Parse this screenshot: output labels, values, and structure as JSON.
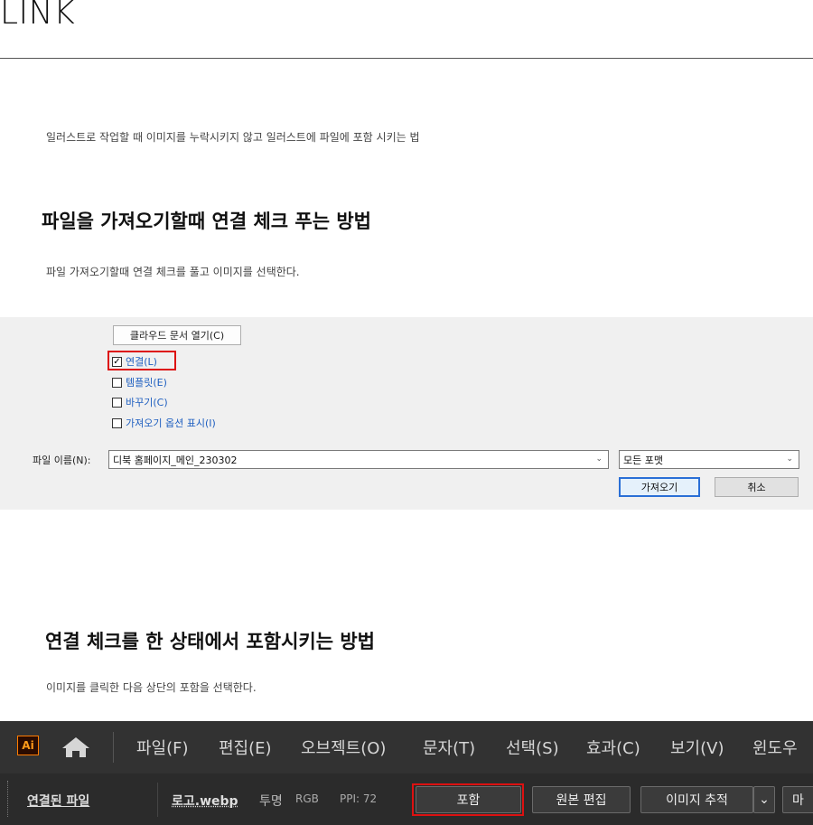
{
  "page": {
    "title": "LINK",
    "intro": "일러스트로 작업할 때 이미지를 누락시키지 않고 일러스트에 파일에 포함 시키는 법",
    "section1": {
      "heading": "파일을 가져오기할때 연결 체크 푸는 방법",
      "desc": "파일 가져오기할때 연결 체크를 풀고 이미지를 선택한다."
    },
    "section2": {
      "heading": "연결 체크를 한 상태에서 포함시키는 방법",
      "desc": "이미지를 클릭한 다음 상단의 포함을 선택한다."
    }
  },
  "dialog": {
    "cloud_button": "클라우드 문서 열기(C)",
    "options": [
      {
        "label": "연결(L)",
        "checked": true
      },
      {
        "label": "템플릿(E)",
        "checked": false
      },
      {
        "label": "바꾸기(C)",
        "checked": false
      },
      {
        "label": "가져오기 옵션 표시(I)",
        "checked": false
      }
    ],
    "filename_label": "파일 이름(N):",
    "filename_value": "디북 홈페이지_메인_230302",
    "format_value": "모든 포맷",
    "import_button": "가져오기",
    "cancel_button": "취소"
  },
  "illustrator": {
    "logo": "Ai",
    "menu": [
      "파일(F)",
      "편집(E)",
      "오브젝트(O)",
      "문자(T)",
      "선택(S)",
      "효과(C)",
      "보기(V)",
      "윈도우"
    ],
    "control": {
      "linked_file": "연결된 파일",
      "filename": "로고.webp",
      "transparency": "투명",
      "color_mode": "RGB",
      "ppi": "PPI: 72",
      "embed_button": "포함",
      "edit_original_button": "원본 편집",
      "image_trace_button": "이미지 추적",
      "trailing_button": "마"
    }
  },
  "colors": {
    "highlight": "#d11111",
    "link_blue": "#1e5fc0",
    "ai_orange": "#ff9a1a"
  }
}
